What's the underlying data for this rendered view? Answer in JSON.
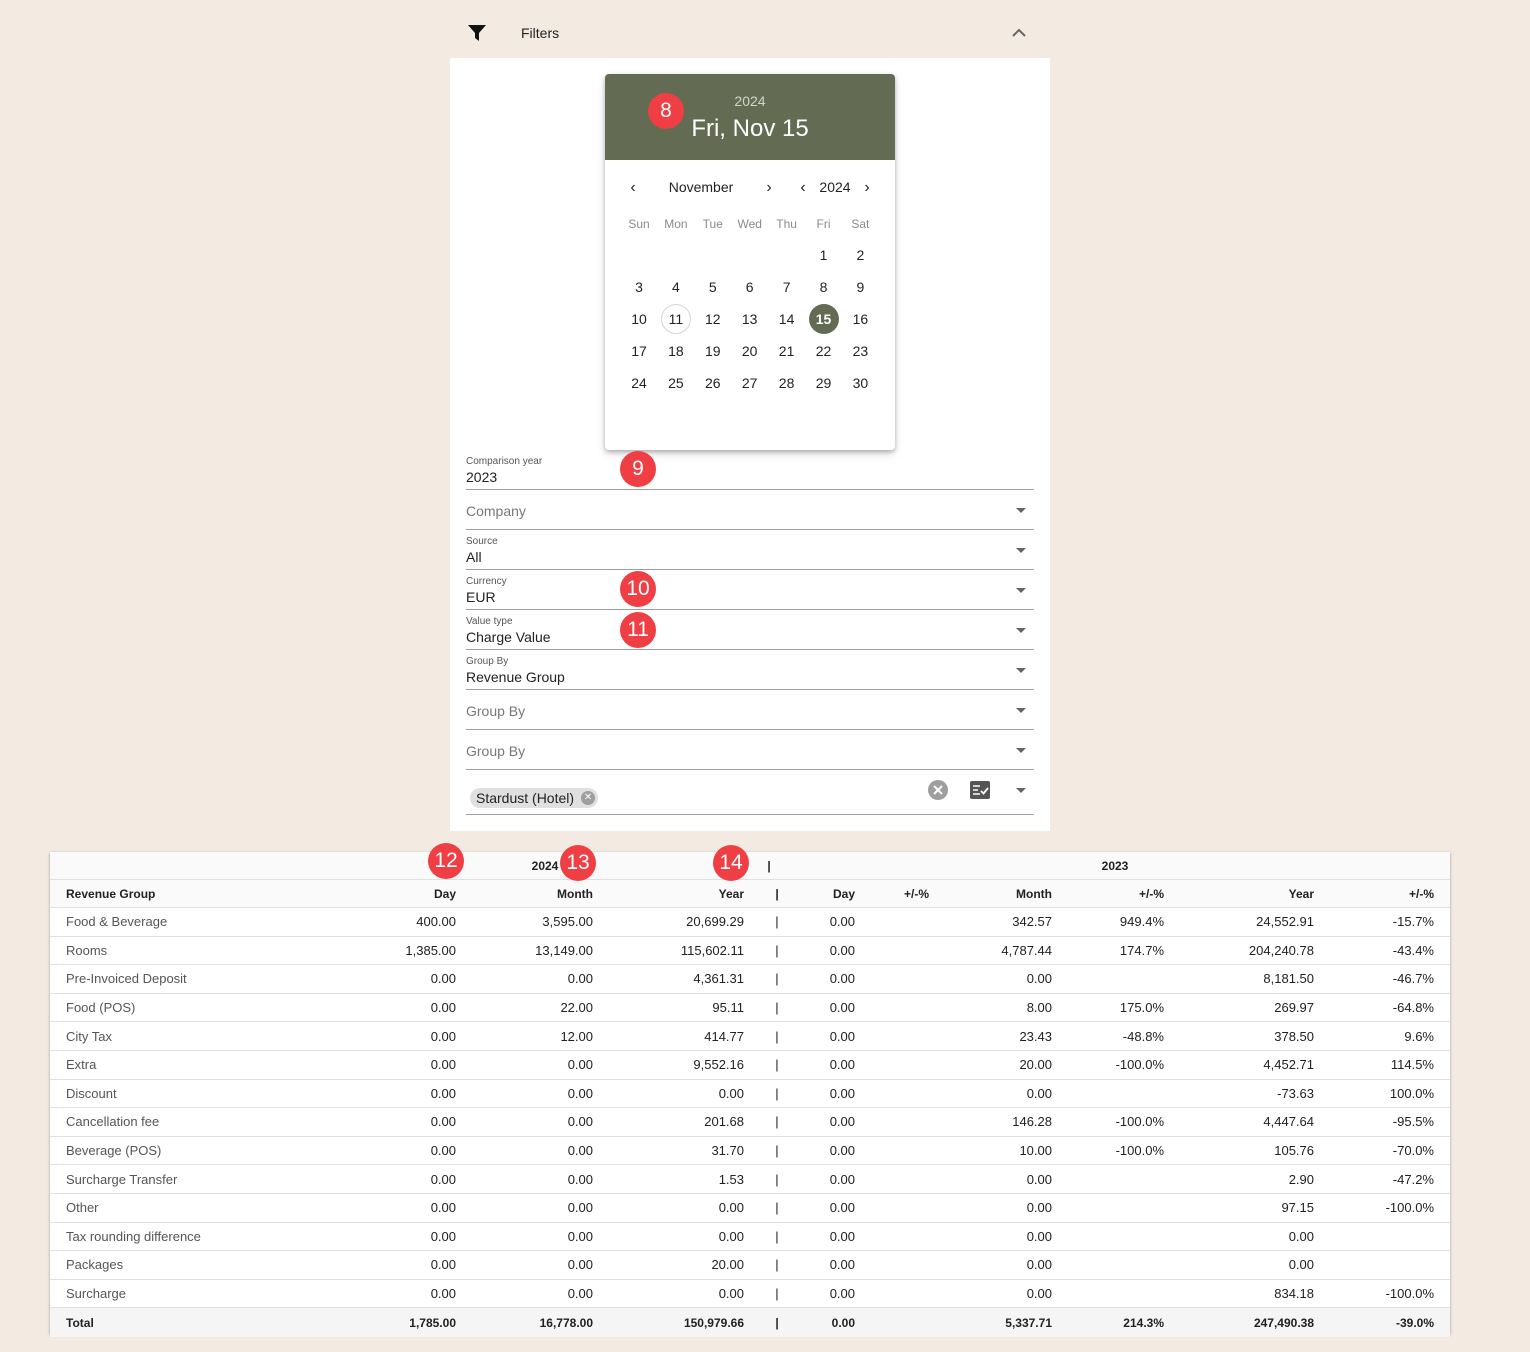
{
  "filters": {
    "title": "Filters",
    "funnel_icon": "filter-icon",
    "collapse_icon": "chevron-up-icon"
  },
  "datepicker": {
    "header_year": "2024",
    "header_date": "Fri, Nov 15",
    "month_label": "November",
    "year_label": "2024",
    "weekdays": [
      "Sun",
      "Mon",
      "Tue",
      "Wed",
      "Thu",
      "Fri",
      "Sat"
    ],
    "weeks": [
      [
        "",
        "",
        "",
        "",
        "",
        "1",
        "2"
      ],
      [
        "3",
        "4",
        "5",
        "6",
        "7",
        "8",
        "9"
      ],
      [
        "10",
        "11",
        "12",
        "13",
        "14",
        "15",
        "16"
      ],
      [
        "17",
        "18",
        "19",
        "20",
        "21",
        "22",
        "23"
      ],
      [
        "24",
        "25",
        "26",
        "27",
        "28",
        "29",
        "30"
      ]
    ],
    "today": "11",
    "selected": "15",
    "accent_color": "#636b53"
  },
  "fields": {
    "comparison_year": {
      "label": "Comparison year",
      "value": "2023"
    },
    "company": {
      "placeholder": "Company"
    },
    "source": {
      "label": "Source",
      "value": "All"
    },
    "currency": {
      "label": "Currency",
      "value": "EUR"
    },
    "value_type": {
      "label": "Value type",
      "value": "Charge Value"
    },
    "group_by_1": {
      "label": "Group By",
      "value": "Revenue Group"
    },
    "group_by_2": {
      "placeholder": "Group By"
    },
    "group_by_3": {
      "placeholder": "Group By"
    },
    "hotels": {
      "chip": "Stardust (Hotel)"
    }
  },
  "badges": [
    "8",
    "9",
    "10",
    "11",
    "12",
    "13",
    "14"
  ],
  "table": {
    "group_headers": {
      "current": "2024",
      "separator": "|",
      "comparison": "2023"
    },
    "columns": [
      "Revenue Group",
      "Day",
      "Month",
      "Year",
      "|",
      "Day",
      "+/-%",
      "Month",
      "+/-%",
      "Year",
      "+/-%"
    ],
    "rows": [
      [
        "Food & Beverage",
        "400.00",
        "3,595.00",
        "20,699.29",
        "|",
        "0.00",
        "",
        "342.57",
        "949.4%",
        "24,552.91",
        "-15.7%"
      ],
      [
        "Rooms",
        "1,385.00",
        "13,149.00",
        "115,602.11",
        "|",
        "0.00",
        "",
        "4,787.44",
        "174.7%",
        "204,240.78",
        "-43.4%"
      ],
      [
        "Pre-Invoiced Deposit",
        "0.00",
        "0.00",
        "4,361.31",
        "|",
        "0.00",
        "",
        "0.00",
        "",
        "8,181.50",
        "-46.7%"
      ],
      [
        "Food (POS)",
        "0.00",
        "22.00",
        "95.11",
        "|",
        "0.00",
        "",
        "8.00",
        "175.0%",
        "269.97",
        "-64.8%"
      ],
      [
        "City Tax",
        "0.00",
        "12.00",
        "414.77",
        "|",
        "0.00",
        "",
        "23.43",
        "-48.8%",
        "378.50",
        "9.6%"
      ],
      [
        "Extra",
        "0.00",
        "0.00",
        "9,552.16",
        "|",
        "0.00",
        "",
        "20.00",
        "-100.0%",
        "4,452.71",
        "114.5%"
      ],
      [
        "Discount",
        "0.00",
        "0.00",
        "0.00",
        "|",
        "0.00",
        "",
        "0.00",
        "",
        "-73.63",
        "100.0%"
      ],
      [
        "Cancellation fee",
        "0.00",
        "0.00",
        "201.68",
        "|",
        "0.00",
        "",
        "146.28",
        "-100.0%",
        "4,447.64",
        "-95.5%"
      ],
      [
        "Beverage (POS)",
        "0.00",
        "0.00",
        "31.70",
        "|",
        "0.00",
        "",
        "10.00",
        "-100.0%",
        "105.76",
        "-70.0%"
      ],
      [
        "Surcharge Transfer",
        "0.00",
        "0.00",
        "1.53",
        "|",
        "0.00",
        "",
        "0.00",
        "",
        "2.90",
        "-47.2%"
      ],
      [
        "Other",
        "0.00",
        "0.00",
        "0.00",
        "|",
        "0.00",
        "",
        "0.00",
        "",
        "97.15",
        "-100.0%"
      ],
      [
        "Tax rounding difference",
        "0.00",
        "0.00",
        "0.00",
        "|",
        "0.00",
        "",
        "0.00",
        "",
        "0.00",
        ""
      ],
      [
        "Packages",
        "0.00",
        "0.00",
        "20.00",
        "|",
        "0.00",
        "",
        "0.00",
        "",
        "0.00",
        ""
      ],
      [
        "Surcharge",
        "0.00",
        "0.00",
        "0.00",
        "|",
        "0.00",
        "",
        "0.00",
        "",
        "834.18",
        "-100.0%"
      ]
    ],
    "total": [
      "Total",
      "1,785.00",
      "16,778.00",
      "150,979.66",
      "|",
      "0.00",
      "",
      "5,337.71",
      "214.3%",
      "247,490.38",
      "-39.0%"
    ]
  }
}
